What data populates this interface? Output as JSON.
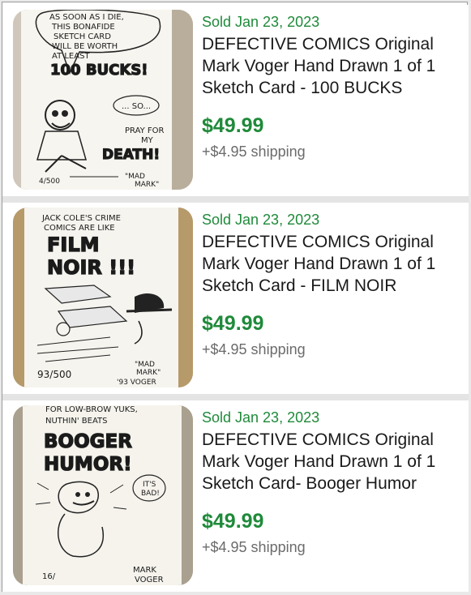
{
  "listings": [
    {
      "sold_label": "Sold  Jan 23, 2023",
      "title": "DEFECTIVE COMICS Original\nMark Voger Hand Drawn 1 of 1\nSketch Card - 100 BUCKS",
      "price": "$49.99",
      "shipping": "+$4.95 shipping",
      "card_text": [
        "AS SOON AS I DIE,",
        "THIS BONAFIDE",
        "SKETCH CARD",
        "WILL BE WORTH",
        "AT LEAST",
        "100 BUCKS!",
        "... SO...",
        "PRAY FOR",
        "MY",
        "DEATH!",
        "4/500",
        "\"MAD",
        "MARK\""
      ]
    },
    {
      "sold_label": "Sold  Jan 23, 2023",
      "title": "DEFECTIVE COMICS Original\nMark Voger Hand Drawn 1 of 1\nSketch Card - FILM NOIR",
      "price": "$49.99",
      "shipping": "+$4.95 shipping",
      "card_text": [
        "JACK COLE'S CRIME",
        "COMICS ARE LIKE",
        "FILM",
        "NOIR !!!",
        "93/500",
        "\"MAD",
        "MARK\"",
        "'93 VOGER"
      ]
    },
    {
      "sold_label": "Sold  Jan 23, 2023",
      "title": "DEFECTIVE COMICS Original\nMark Voger Hand Drawn 1 of 1\nSketch Card- Booger Humor",
      "price": "$49.99",
      "shipping": "+$4.95 shipping",
      "card_text": [
        "FOR LOW-BROW YUKS,",
        "NUTHIN' BEATS",
        "BOOGER",
        "HUMOR!",
        "IT'S",
        "BAD!",
        "16/",
        "MARK",
        "VOGER"
      ]
    }
  ]
}
